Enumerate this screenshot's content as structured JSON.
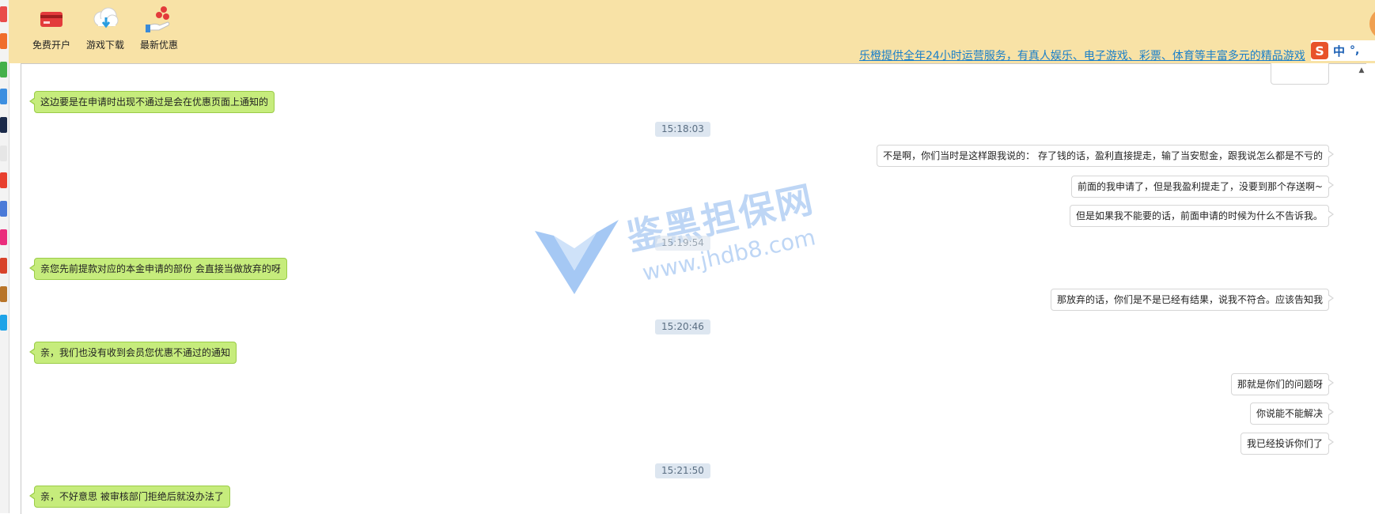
{
  "toolbar": {
    "items": [
      {
        "label": "免费开户",
        "icon": "credit-card-icon"
      },
      {
        "label": "游戏下载",
        "icon": "cloud-download-icon"
      },
      {
        "label": "最新优惠",
        "icon": "hand-coins-icon"
      }
    ],
    "notice": "乐橙提供全年24小时运营服务，有真人娱乐、电子游戏、彩票、体育等丰富多元的精品游戏"
  },
  "ime": {
    "brand": "S",
    "mode": "中",
    "punct": "°,"
  },
  "watermark": {
    "name": "鉴黑担保网",
    "url": "www.jhdb8.com"
  },
  "chat": {
    "messages": [
      {
        "side": "in",
        "text": "这边要是在申请时出现不通过是会在优惠页面上通知的"
      },
      {
        "side": "time",
        "text": "15:18:03"
      },
      {
        "side": "out",
        "text": "不是啊，你们当时是这样跟我说的： 存了钱的话，盈利直接提走，输了当安慰金，跟我说怎么都是不亏的"
      },
      {
        "side": "out",
        "text": "前面的我申请了，但是我盈利提走了，没要到那个存送啊~"
      },
      {
        "side": "out",
        "text": "但是如果我不能要的话，前面申请的时候为什么不告诉我。"
      },
      {
        "side": "time",
        "text": "15:19:54"
      },
      {
        "side": "in",
        "text": "亲您先前提款对应的本金申请的部份 会直接当做放弃的呀"
      },
      {
        "side": "out",
        "text": "那放弃的话，你们是不是已经有结果，说我不符合。应该告知我"
      },
      {
        "side": "time",
        "text": "15:20:46"
      },
      {
        "side": "in",
        "text": "亲，我们也没有收到会员您优惠不通过的通知"
      },
      {
        "side": "out",
        "text": "那就是你们的问题呀"
      },
      {
        "side": "out",
        "text": "你说能不能解决"
      },
      {
        "side": "out",
        "text": "我已经投诉你们了"
      },
      {
        "side": "time",
        "text": "15:21:50"
      },
      {
        "side": "in",
        "text": "亲，不好意思 被审核部门拒绝后就没办法了"
      }
    ]
  },
  "colors": {
    "header_bg": "#f8e2a6",
    "incoming_bubble": "#c6ec7c",
    "outgoing_bubble": "#ffffff",
    "time_badge": "#dde6f0",
    "notice_link": "#1a7fc9"
  }
}
